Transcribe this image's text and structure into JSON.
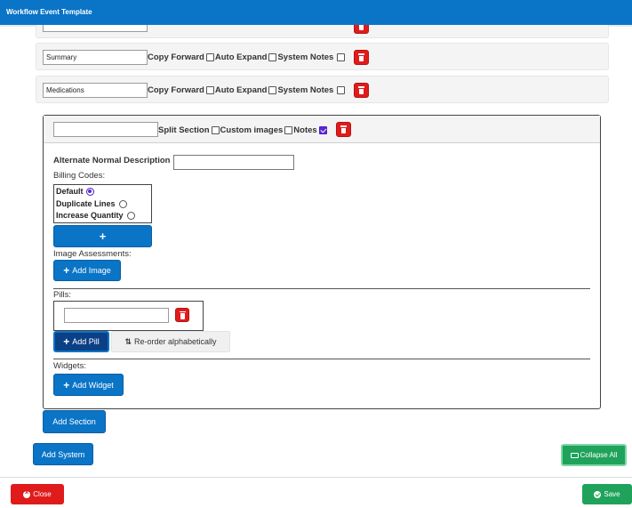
{
  "window": {
    "title": "Workflow Event Template"
  },
  "systems": [
    {
      "name": "Summary",
      "copy_forward": "Copy Forward",
      "auto_expand": "Auto Expand",
      "system_notes": "System Notes"
    },
    {
      "name": "Medications",
      "copy_forward": "Copy Forward",
      "auto_expand": "Auto Expand",
      "system_notes": "System Notes"
    }
  ],
  "section": {
    "name": "",
    "split_section": "Split Section",
    "custom_images": "Custom images",
    "notes": "Notes",
    "notes_checked": true,
    "alt_normal_label": "Alternate Normal Description",
    "alt_normal_value": "",
    "billing_label": "Billing Codes:",
    "billing_options": [
      {
        "label": "Default",
        "selected": true
      },
      {
        "label": "Duplicate Lines",
        "selected": false
      },
      {
        "label": "Increase Quantity",
        "selected": false
      }
    ],
    "add_billing": "+",
    "image_assessments_label": "Image Assessments:",
    "add_image": "Add Image",
    "pills_label": "Pills:",
    "pill_value": "",
    "add_pill": "Add Pill",
    "reorder": "Re-order alphabetically",
    "widgets_label": "Widgets:",
    "add_widget": "Add Widget"
  },
  "add_section": "Add Section",
  "add_system": "Add System",
  "collapse_all": "Collapse All",
  "footer": {
    "close": "Close",
    "save": "Save"
  },
  "colors": {
    "primary": "#0a74c6",
    "danger": "#e01b1b",
    "success": "#1fa35a",
    "check": "#5b29d6"
  },
  "icons": {
    "delete": "trash-icon",
    "add": "plus-icon",
    "sort": "sort-icon",
    "collapse": "folder-open-icon",
    "close": "times-circle-icon",
    "save": "check-circle-icon"
  }
}
